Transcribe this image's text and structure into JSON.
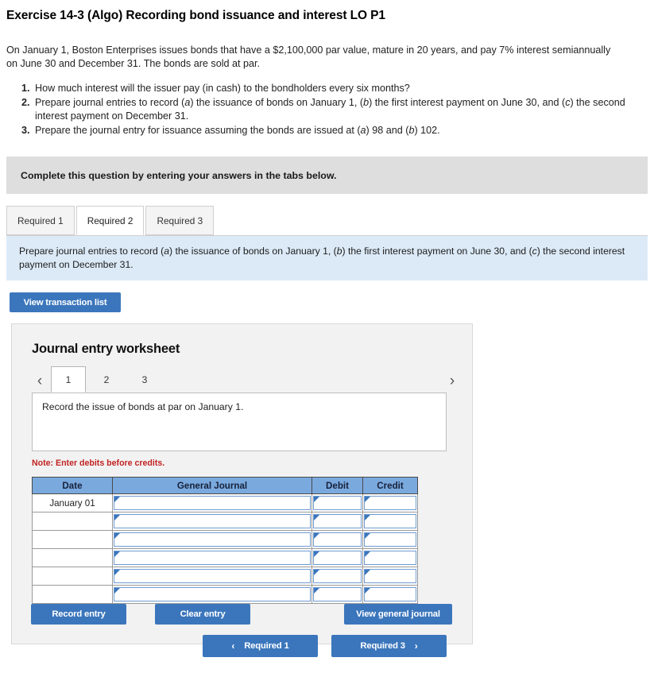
{
  "page_title": "Exercise 14-3 (Algo) Recording bond issuance and interest LO P1",
  "problem": {
    "line1": "On January 1, Boston Enterprises issues bonds that have a $2,100,000 par value, mature in 20 years, and pay 7% interest semiannually",
    "line2": "on June 30 and December 31. The bonds are sold at par."
  },
  "requirements": [
    {
      "num": "1.",
      "text": "How much interest will the issuer pay (in cash) to the bondholders every six months?"
    },
    {
      "num": "2.",
      "text_a": "Prepare journal entries to record (",
      "i1": "a",
      "text_b": ") the issuance of bonds on January 1, (",
      "i2": "b",
      "text_c": ") the first interest payment on June 30, and (",
      "i3": "c",
      "text_d": ") the second interest payment on December 31."
    },
    {
      "num": "3.",
      "text_a": "Prepare the journal entry for issuance assuming the bonds are issued at (",
      "i1": "a",
      "text_b": ") 98 and (",
      "i2": "b",
      "text_c": ") 102."
    }
  ],
  "instruction_bar": {
    "text": "Complete this question by entering your answers in the tabs below."
  },
  "tabs": [
    {
      "label": "Required 1",
      "active": false
    },
    {
      "label": "Required 2",
      "active": true
    },
    {
      "label": "Required 3",
      "active": false
    }
  ],
  "info_panel": {
    "text_a": "Prepare journal entries to record (",
    "i1": "a",
    "text_b": ") the issuance of bonds on January 1, (",
    "i2": "b",
    "text_c": ") the first interest payment on June 30, and (",
    "i3": "c",
    "text_d": ") the second interest payment on December 31."
  },
  "view_transaction_list_label": "View transaction list",
  "worksheet": {
    "title": "Journal entry worksheet",
    "pages": [
      "1",
      "2",
      "3"
    ],
    "active_page": "1",
    "prev_icon": "chevron-left-icon",
    "next_icon": "chevron-right-icon",
    "description": "Record the issue of bonds at par on January 1.",
    "note": "Note: Enter debits before credits.",
    "table": {
      "headers": [
        "Date",
        "General Journal",
        "Debit",
        "Credit"
      ],
      "rows": [
        {
          "date": "January 01",
          "general_journal": "",
          "debit": "",
          "credit": ""
        },
        {
          "date": "",
          "general_journal": "",
          "debit": "",
          "credit": ""
        },
        {
          "date": "",
          "general_journal": "",
          "debit": "",
          "credit": ""
        },
        {
          "date": "",
          "general_journal": "",
          "debit": "",
          "credit": ""
        },
        {
          "date": "",
          "general_journal": "",
          "debit": "",
          "credit": ""
        },
        {
          "date": "",
          "general_journal": "",
          "debit": "",
          "credit": ""
        }
      ]
    },
    "buttons": {
      "record_entry": "Record entry",
      "clear_entry": "Clear entry",
      "view_general_journal": "View general journal"
    }
  },
  "bottom_nav": {
    "prev_label": "Required 1",
    "prev_arrow": "‹",
    "next_label": "Required 3",
    "next_arrow": "›"
  },
  "colors": {
    "accent_blue": "#3b76bc",
    "table_header_blue": "#7aa9de",
    "info_panel_blue": "#dceaf7",
    "instruction_gray": "#dedede",
    "panel_gray": "#f2f2f2",
    "note_red": "#c22222"
  }
}
